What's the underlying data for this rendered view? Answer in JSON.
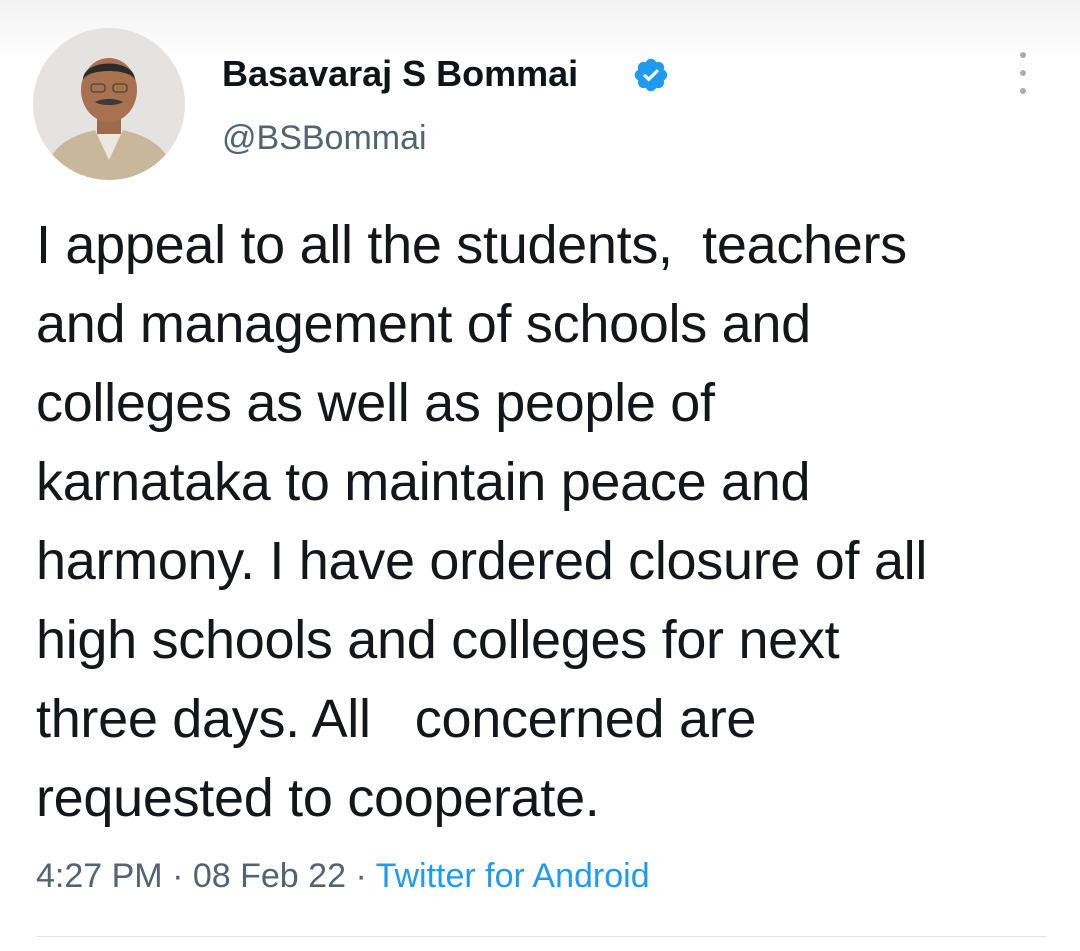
{
  "author": {
    "display_name": "Basavaraj S Bommai",
    "handle": "@BSBommai",
    "verified": true,
    "avatar_icon": "profile-photo"
  },
  "tweet": {
    "text": "I appeal to all the students,  teachers\nand management of schools and\ncolleges as well as people of\nkarnataka to maintain peace and\nharmony. I have ordered closure of all\nhigh schools and colleges for next\nthree days. All   concerned are\nrequested to cooperate.",
    "time": "4:27 PM",
    "separator": "·",
    "date": "08 Feb 22",
    "source": "Twitter for Android"
  },
  "colors": {
    "text_primary": "#0f1419",
    "text_secondary": "#536471",
    "accent": "#1d9bf0"
  },
  "icons": {
    "verified": "verified-badge-icon",
    "more": "more-vertical-icon"
  }
}
